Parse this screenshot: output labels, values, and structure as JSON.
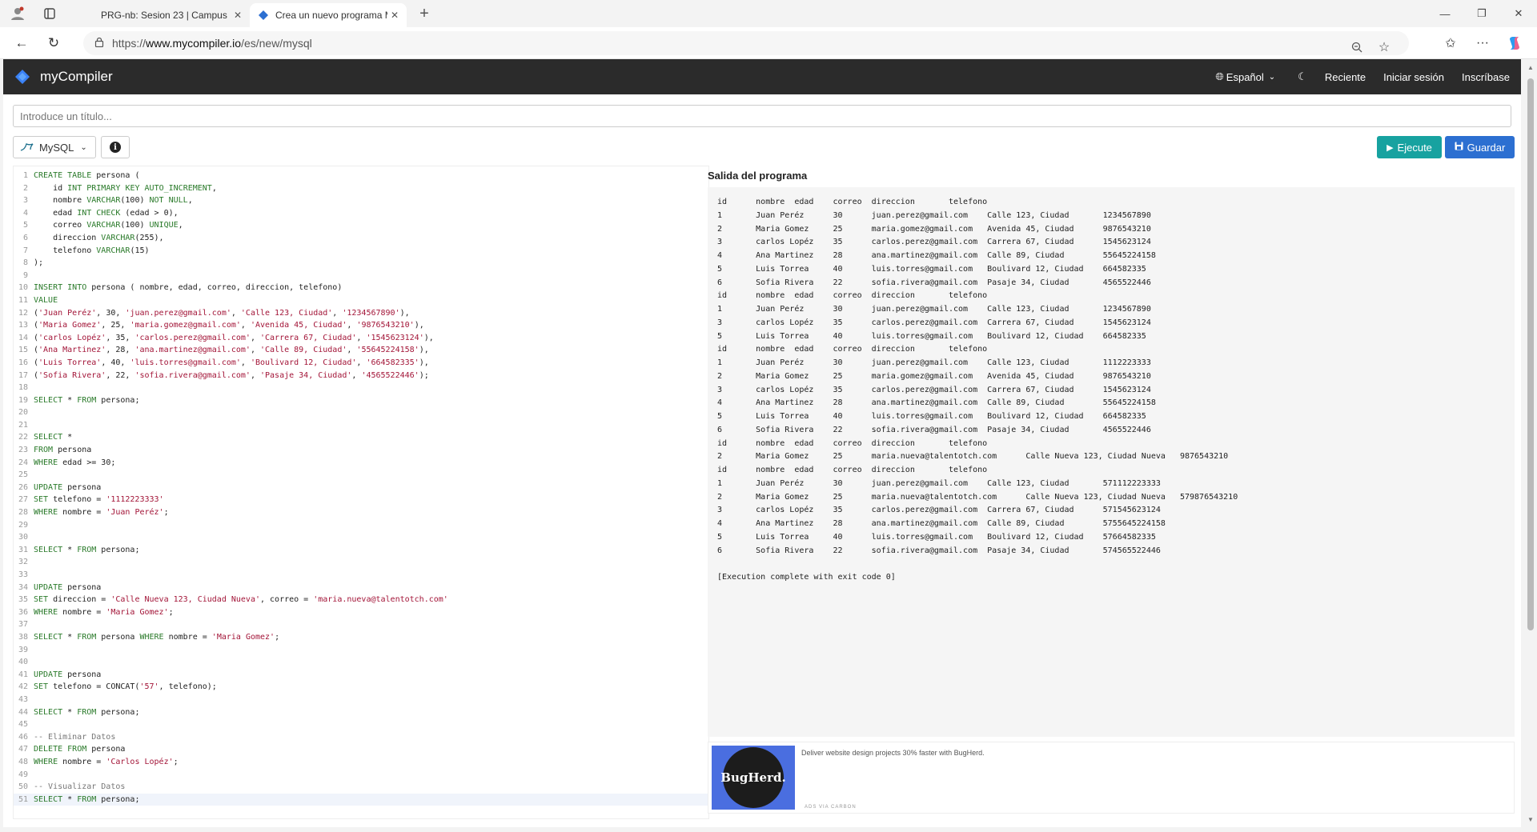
{
  "browser": {
    "tabs": [
      {
        "title": "PRG-nb: Sesion 23 | Campus",
        "active": false
      },
      {
        "title": "Crea un nuevo programa MySQL",
        "active": true
      }
    ],
    "url_prefix": "https://",
    "url_host": "www.mycompiler.io",
    "url_path": "/es/new/mysql"
  },
  "site": {
    "brand": "myCompiler",
    "language": "Español",
    "nav": [
      "Reciente",
      "Iniciar sesión",
      "Inscríbase"
    ]
  },
  "editor": {
    "title_placeholder": "Introduce un título...",
    "language_label": "MySQL",
    "run_label": "Ejecute",
    "save_label": "Guardar",
    "current_line": 51,
    "lines": [
      "CREATE TABLE persona (",
      "    id INT PRIMARY KEY AUTO_INCREMENT,",
      "    nombre VARCHAR(100) NOT NULL,",
      "    edad INT CHECK (edad > 0),",
      "    correo VARCHAR(100) UNIQUE,",
      "    direccion VARCHAR(255),",
      "    telefono VARCHAR(15)",
      ");",
      "",
      "INSERT INTO persona ( nombre, edad, correo, direccion, telefono)",
      "VALUE",
      "('Juan Peréz', 30, 'juan.perez@gmail.com', 'Calle 123, Ciudad', '1234567890'),",
      "('Maria Gomez', 25, 'maria.gomez@gmail.com', 'Avenida 45, Ciudad', '9876543210'),",
      "('carlos Lopéz', 35, 'carlos.perez@gmail.com', 'Carrera 67, Ciudad', '1545623124'),",
      "('Ana Martinez', 28, 'ana.martinez@gmail.com', 'Calle 89, Ciudad', '55645224158'),",
      "('Luis Torrea', 40, 'luis.torres@gmail.com', 'Boulivard 12, Ciudad', '664582335'),",
      "('Sofia Rivera', 22, 'sofia.rivera@gmail.com', 'Pasaje 34, Ciudad', '4565522446');",
      "",
      "SELECT * FROM persona;",
      "",
      "",
      "SELECT *",
      "FROM persona",
      "WHERE edad >= 30;",
      "",
      "UPDATE persona",
      "SET telefono = '1112223333'",
      "WHERE nombre = 'Juan Peréz';",
      "",
      "",
      "SELECT * FROM persona;",
      "",
      "",
      "UPDATE persona",
      "SET direccion = 'Calle Nueva 123, Ciudad Nueva', correo = 'maria.nueva@talentotch.com'",
      "WHERE nombre = 'Maria Gomez';",
      "",
      "SELECT * FROM persona WHERE nombre = 'Maria Gomez';",
      "",
      "",
      "UPDATE persona",
      "SET telefono = CONCAT('57', telefono);",
      "",
      "SELECT * FROM persona;",
      "",
      "-- Eliminar Datos",
      "DELETE FROM persona",
      "WHERE nombre = 'Carlos Lopéz';",
      "",
      "-- Visualizar Datos",
      "SELECT * FROM persona;"
    ]
  },
  "output": {
    "title": "Salida del programa",
    "lines": [
      "id      nombre  edad    correo  direccion       telefono",
      "1       Juan Peréz      30      juan.perez@gmail.com    Calle 123, Ciudad       1234567890",
      "2       Maria Gomez     25      maria.gomez@gmail.com   Avenida 45, Ciudad      9876543210",
      "3       carlos Lopéz    35      carlos.perez@gmail.com  Carrera 67, Ciudad      1545623124",
      "4       Ana Martinez    28      ana.martinez@gmail.com  Calle 89, Ciudad        55645224158",
      "5       Luis Torrea     40      luis.torres@gmail.com   Boulivard 12, Ciudad    664582335",
      "6       Sofia Rivera    22      sofia.rivera@gmail.com  Pasaje 34, Ciudad       4565522446",
      "id      nombre  edad    correo  direccion       telefono",
      "1       Juan Peréz      30      juan.perez@gmail.com    Calle 123, Ciudad       1234567890",
      "3       carlos Lopéz    35      carlos.perez@gmail.com  Carrera 67, Ciudad      1545623124",
      "5       Luis Torrea     40      luis.torres@gmail.com   Boulivard 12, Ciudad    664582335",
      "id      nombre  edad    correo  direccion       telefono",
      "1       Juan Peréz      30      juan.perez@gmail.com    Calle 123, Ciudad       1112223333",
      "2       Maria Gomez     25      maria.gomez@gmail.com   Avenida 45, Ciudad      9876543210",
      "3       carlos Lopéz    35      carlos.perez@gmail.com  Carrera 67, Ciudad      1545623124",
      "4       Ana Martinez    28      ana.martinez@gmail.com  Calle 89, Ciudad        55645224158",
      "5       Luis Torrea     40      luis.torres@gmail.com   Boulivard 12, Ciudad    664582335",
      "6       Sofia Rivera    22      sofia.rivera@gmail.com  Pasaje 34, Ciudad       4565522446",
      "id      nombre  edad    correo  direccion       telefono",
      "2       Maria Gomez     25      maria.nueva@talentotch.com      Calle Nueva 123, Ciudad Nueva   9876543210",
      "id      nombre  edad    correo  direccion       telefono",
      "1       Juan Peréz      30      juan.perez@gmail.com    Calle 123, Ciudad       571112223333",
      "2       Maria Gomez     25      maria.nueva@talentotch.com      Calle Nueva 123, Ciudad Nueva   579876543210",
      "3       carlos Lopéz    35      carlos.perez@gmail.com  Carrera 67, Ciudad      571545623124",
      "4       Ana Martinez    28      ana.martinez@gmail.com  Calle 89, Ciudad        5755645224158",
      "5       Luis Torrea     40      luis.torres@gmail.com   Boulivard 12, Ciudad    57664582335",
      "6       Sofia Rivera    22      sofia.rivera@gmail.com  Pasaje 34, Ciudad       574565522446",
      "",
      "[Execution complete with exit code 0]"
    ]
  },
  "ad": {
    "brand": "BugHerd.",
    "text": "Deliver website design projects 30% faster with BugHerd.",
    "via": "ADS VIA CARBON"
  },
  "colors": {
    "header_bg": "#2b2b2b",
    "run_button": "#17a2a0",
    "save_button": "#2c6fd1",
    "keyword": "#2a7a2a",
    "string": "#a31538"
  }
}
